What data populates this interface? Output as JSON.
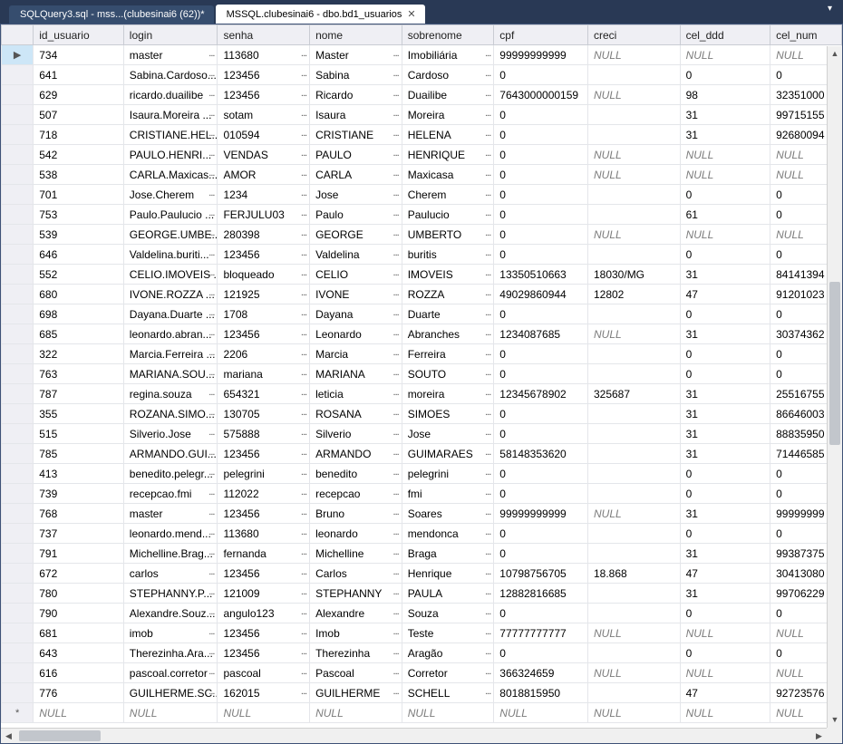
{
  "tabs": [
    {
      "label": "SQLQuery3.sql - mss...(clubesinai6 (62))*",
      "active": false
    },
    {
      "label": "MSSQL.clubesinai6 - dbo.bd1_usuarios",
      "active": true
    }
  ],
  "columns": [
    "id_usuario",
    "login",
    "senha",
    "nome",
    "sobrenome",
    "cpf",
    "creci",
    "cel_ddd",
    "cel_num"
  ],
  "null_label": "NULL",
  "new_row_marker": "*",
  "rows": [
    {
      "id": "734",
      "login": "master",
      "senha": "113680",
      "nome": "Master",
      "sobrenome": "Imobiliária",
      "cpf": "99999999999",
      "creci": null,
      "ddd": null,
      "num": null,
      "sel": true
    },
    {
      "id": "641",
      "login": "Sabina.Cardoso...",
      "senha": "123456",
      "nome": "Sabina",
      "sobrenome": "Cardoso",
      "cpf": "0",
      "creci": "",
      "ddd": "0",
      "num": "0"
    },
    {
      "id": "629",
      "login": "ricardo.duailibe",
      "senha": "123456",
      "nome": "Ricardo",
      "sobrenome": "Duailibe",
      "cpf": "7643000000159",
      "creci": null,
      "ddd": "98",
      "num": "32351000"
    },
    {
      "id": "507",
      "login": "Isaura.Moreira ...",
      "senha": "sotam",
      "nome": "Isaura",
      "sobrenome": "Moreira",
      "cpf": "0",
      "creci": "",
      "ddd": "31",
      "num": "99715155"
    },
    {
      "id": "718",
      "login": "CRISTIANE.HEL...",
      "senha": "010594",
      "nome": "CRISTIANE",
      "sobrenome": "HELENA",
      "cpf": "0",
      "creci": "",
      "ddd": "31",
      "num": "92680094"
    },
    {
      "id": "542",
      "login": "PAULO.HENRI...",
      "senha": "VENDAS",
      "nome": "PAULO",
      "sobrenome": "HENRIQUE",
      "cpf": "0",
      "creci": null,
      "ddd": null,
      "num": null
    },
    {
      "id": "538",
      "login": "CARLA.Maxicas...",
      "senha": "AMOR",
      "nome": "CARLA",
      "sobrenome": "Maxicasa",
      "cpf": "0",
      "creci": null,
      "ddd": null,
      "num": null
    },
    {
      "id": "701",
      "login": "Jose.Cherem",
      "senha": "1234",
      "nome": "Jose",
      "sobrenome": "Cherem",
      "cpf": "0",
      "creci": "",
      "ddd": "0",
      "num": "0"
    },
    {
      "id": "753",
      "login": "Paulo.Paulucio ...",
      "senha": "FERJULU03",
      "nome": "Paulo",
      "sobrenome": "Paulucio",
      "cpf": "0",
      "creci": "",
      "ddd": "61",
      "num": "0"
    },
    {
      "id": "539",
      "login": "GEORGE.UMBE...",
      "senha": "280398",
      "nome": "GEORGE",
      "sobrenome": "UMBERTO",
      "cpf": "0",
      "creci": null,
      "ddd": null,
      "num": null
    },
    {
      "id": "646",
      "login": "Valdelina.buriti...",
      "senha": "123456",
      "nome": "Valdelina",
      "sobrenome": "buritis",
      "cpf": "0",
      "creci": "",
      "ddd": "0",
      "num": "0"
    },
    {
      "id": "552",
      "login": "CELIO.IMOVEIS ...",
      "senha": "bloqueado",
      "nome": "CELIO",
      "sobrenome": "IMOVEIS",
      "cpf": "13350510663",
      "creci": "18030/MG",
      "ddd": "31",
      "num": "84141394"
    },
    {
      "id": "680",
      "login": "IVONE.ROZZA ...",
      "senha": "121925",
      "nome": "IVONE",
      "sobrenome": "ROZZA",
      "cpf": "49029860944",
      "creci": "12802",
      "ddd": "47",
      "num": "91201023"
    },
    {
      "id": "698",
      "login": "Dayana.Duarte ...",
      "senha": "1708",
      "nome": "Dayana",
      "sobrenome": "Duarte",
      "cpf": "0",
      "creci": "",
      "ddd": "0",
      "num": "0"
    },
    {
      "id": "685",
      "login": "leonardo.abran...",
      "senha": "123456",
      "nome": "Leonardo",
      "sobrenome": "Abranches",
      "cpf": "1234087685",
      "creci": null,
      "ddd": "31",
      "num": "30374362"
    },
    {
      "id": "322",
      "login": "Marcia.Ferreira ...",
      "senha": "2206",
      "nome": "Marcia",
      "sobrenome": "Ferreira",
      "cpf": "0",
      "creci": "",
      "ddd": "0",
      "num": "0"
    },
    {
      "id": "763",
      "login": "MARIANA.SOU...",
      "senha": "mariana",
      "nome": "MARIANA",
      "sobrenome": "SOUTO",
      "cpf": "0",
      "creci": "",
      "ddd": "0",
      "num": "0"
    },
    {
      "id": "787",
      "login": "regina.souza",
      "senha": "654321",
      "nome": "leticia",
      "sobrenome": "moreira",
      "cpf": "12345678902",
      "creci": "325687",
      "ddd": "31",
      "num": "25516755"
    },
    {
      "id": "355",
      "login": "ROZANA.SIMO...",
      "senha": "130705",
      "nome": "ROSANA",
      "sobrenome": "SIMOES",
      "cpf": "0",
      "creci": "",
      "ddd": "31",
      "num": "86646003"
    },
    {
      "id": "515",
      "login": "Silverio.Jose",
      "senha": "575888",
      "nome": "Silverio",
      "sobrenome": "Jose",
      "cpf": "0",
      "creci": "",
      "ddd": "31",
      "num": "88835950"
    },
    {
      "id": "785",
      "login": "ARMANDO.GUI...",
      "senha": "123456",
      "nome": "ARMANDO",
      "sobrenome": "GUIMARAES",
      "cpf": "58148353620",
      "creci": "",
      "ddd": "31",
      "num": "71446585"
    },
    {
      "id": "413",
      "login": "benedito.pelegr...",
      "senha": "pelegrini",
      "nome": "benedito",
      "sobrenome": "pelegrini",
      "cpf": "0",
      "creci": "",
      "ddd": "0",
      "num": "0"
    },
    {
      "id": "739",
      "login": "recepcao.fmi",
      "senha": "112022",
      "nome": "recepcao",
      "sobrenome": "fmi",
      "cpf": "0",
      "creci": "",
      "ddd": "0",
      "num": "0"
    },
    {
      "id": "768",
      "login": "master",
      "senha": "123456",
      "nome": "Bruno",
      "sobrenome": "Soares",
      "cpf": "99999999999",
      "creci": null,
      "ddd": "31",
      "num": "99999999"
    },
    {
      "id": "737",
      "login": "leonardo.mend...",
      "senha": "113680",
      "nome": "leonardo",
      "sobrenome": "mendonca",
      "cpf": "0",
      "creci": "",
      "ddd": "0",
      "num": "0"
    },
    {
      "id": "791",
      "login": "Michelline.Brag...",
      "senha": "fernanda",
      "nome": "Michelline",
      "sobrenome": "Braga",
      "cpf": "0",
      "creci": "",
      "ddd": "31",
      "num": "99387375"
    },
    {
      "id": "672",
      "login": "carlos",
      "senha": "123456",
      "nome": "Carlos",
      "sobrenome": "Henrique",
      "cpf": "10798756705",
      "creci": "18.868",
      "ddd": "47",
      "num": "30413080"
    },
    {
      "id": "780",
      "login": "STEPHANNY.P...",
      "senha": "121009",
      "nome": "STEPHANNY",
      "sobrenome": "PAULA",
      "cpf": "12882816685",
      "creci": "",
      "ddd": "31",
      "num": "99706229"
    },
    {
      "id": "790",
      "login": "Alexandre.Souz...",
      "senha": "angulo123",
      "nome": "Alexandre",
      "sobrenome": "Souza",
      "cpf": "0",
      "creci": "",
      "ddd": "0",
      "num": "0"
    },
    {
      "id": "681",
      "login": "imob",
      "senha": "123456",
      "nome": "Imob",
      "sobrenome": "Teste",
      "cpf": "77777777777",
      "creci": null,
      "ddd": null,
      "num": null
    },
    {
      "id": "643",
      "login": "Therezinha.Ara...",
      "senha": "123456",
      "nome": "Therezinha",
      "sobrenome": "Aragão",
      "cpf": "0",
      "creci": "",
      "ddd": "0",
      "num": "0"
    },
    {
      "id": "616",
      "login": "pascoal.corretor",
      "senha": "pascoal",
      "nome": "Pascoal",
      "sobrenome": "Corretor",
      "cpf": "366324659",
      "creci": null,
      "ddd": null,
      "num": null
    },
    {
      "id": "776",
      "login": "GUILHERME.SC...",
      "senha": "162015",
      "nome": "GUILHERME",
      "sobrenome": "SCHELL",
      "cpf": "8018815950",
      "creci": "",
      "ddd": "47",
      "num": "92723576"
    }
  ]
}
